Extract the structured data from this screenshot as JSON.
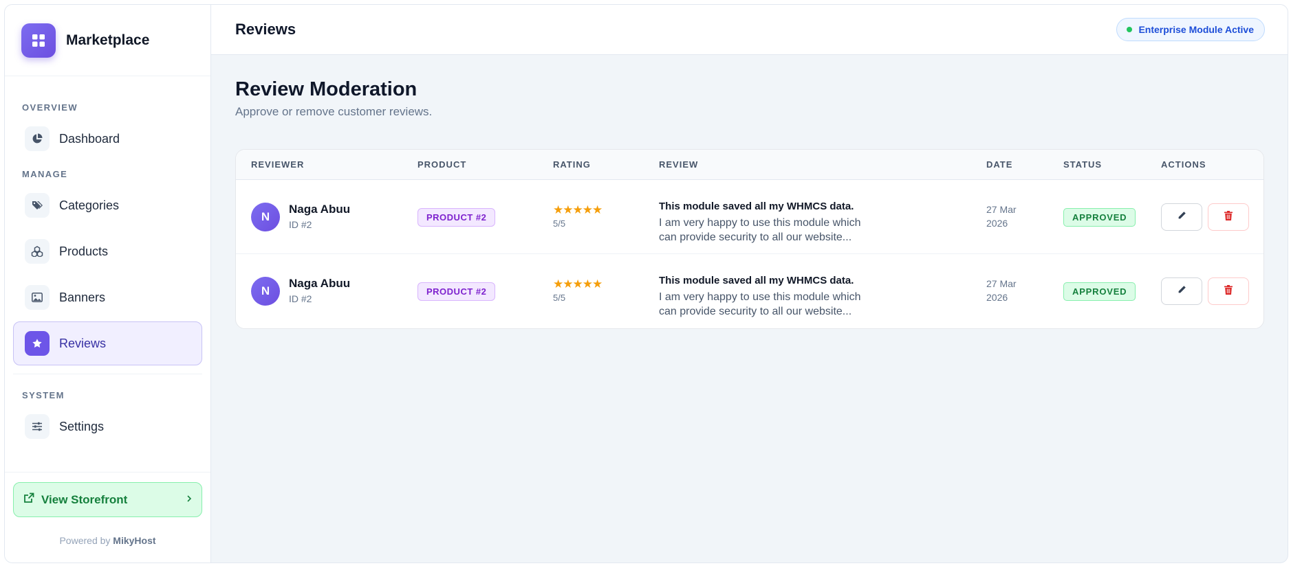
{
  "brand": {
    "name": "Marketplace",
    "logo_icon": "grid-icon",
    "accent": "#6d55e8"
  },
  "sidebar": {
    "sections": [
      {
        "label": "OVERVIEW",
        "items": [
          {
            "label": "Dashboard",
            "icon": "pie-chart-icon"
          }
        ]
      },
      {
        "label": "MANAGE",
        "items": [
          {
            "label": "Categories",
            "icon": "tags-icon"
          },
          {
            "label": "Products",
            "icon": "boxes-icon"
          },
          {
            "label": "Banners",
            "icon": "image-icon"
          },
          {
            "label": "Reviews",
            "icon": "star-icon",
            "active": true
          }
        ]
      },
      {
        "label": "SYSTEM",
        "items": [
          {
            "label": "Settings",
            "icon": "sliders-icon"
          }
        ]
      }
    ],
    "storefront_label": "View Storefront",
    "powered_prefix": "Powered by",
    "powered_brand": "MikyHost"
  },
  "header": {
    "title": "Reviews",
    "badge": {
      "text": "Enterprise Module Active",
      "dot_color": "#22c55e"
    }
  },
  "page": {
    "title": "Review Moderation",
    "subtitle": "Approve or remove customer reviews."
  },
  "table": {
    "columns": [
      "REVIEWER",
      "PRODUCT",
      "RATING",
      "REVIEW",
      "DATE",
      "STATUS",
      "ACTIONS"
    ],
    "rows": [
      {
        "avatar_initial": "N",
        "reviewer": "Naga Abuu",
        "reviewer_id": "ID #2",
        "product": "PRODUCT #2",
        "stars": "★★★★★",
        "rating": "5/5",
        "review_title": "This module saved all my WHMCS data.",
        "review_body": "I am very happy to use this module which can provide security to all our website...",
        "date": "27 Mar 2026",
        "status": "APPROVED"
      },
      {
        "avatar_initial": "N",
        "reviewer": "Naga Abuu",
        "reviewer_id": "ID #2",
        "product": "PRODUCT #2",
        "stars": "★★★★★",
        "rating": "5/5",
        "review_title": "This module saved all my WHMCS data.",
        "review_body": "I am very happy to use this module which can provide security to all our website...",
        "date": "27 Mar 2026",
        "status": "APPROVED"
      }
    ]
  }
}
